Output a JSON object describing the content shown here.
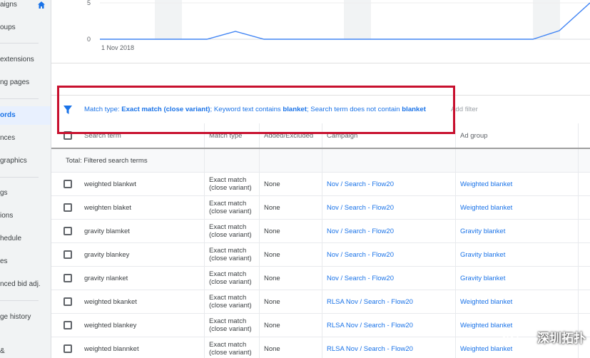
{
  "sidebar": {
    "items": [
      {
        "label": "aigns",
        "active": false
      },
      {
        "label": "oups",
        "active": false
      },
      {
        "label": "extensions",
        "active": false
      },
      {
        "label": "ng pages",
        "active": false
      },
      {
        "label": "ords",
        "active": true
      },
      {
        "label": "nces",
        "active": false
      },
      {
        "label": "graphics",
        "active": false
      },
      {
        "label": "gs",
        "active": false
      },
      {
        "label": "ions",
        "active": false
      },
      {
        "label": "hedule",
        "active": false
      },
      {
        "label": "es",
        "active": false
      },
      {
        "label": "nced bid adj.",
        "active": false
      },
      {
        "label": "ge history",
        "active": false
      },
      {
        "label": "&",
        "active": false
      }
    ],
    "home_icon": "home-icon"
  },
  "chart": {
    "yticks": [
      "5",
      "0"
    ],
    "xlabel": "1 Nov 2018",
    "colors": {
      "line": "#4285f4",
      "band": "#f1f3f4"
    }
  },
  "filter": {
    "icon": "filter-icon",
    "parts": [
      {
        "text": "Match type: ",
        "bold": false
      },
      {
        "text": "Exact match (close variant)",
        "bold": true
      },
      {
        "text": "; Keyword text contains ",
        "bold": false
      },
      {
        "text": "blanket",
        "bold": true
      },
      {
        "text": "; Search term does not contain ",
        "bold": false
      },
      {
        "text": "blanket",
        "bold": true
      }
    ],
    "add_filter": "Add filter",
    "highlight_color": "#c8102e"
  },
  "table": {
    "headers": {
      "search_term": "Search term",
      "match_type": "Match type",
      "added_excluded": "Added/Excluded",
      "campaign": "Campaign",
      "ad_group": "Ad group"
    },
    "total_label": "Total: Filtered search terms",
    "rows": [
      {
        "term": "weighted blankwt",
        "match1": "Exact match",
        "match2": "(close variant)",
        "added": "None",
        "campaign": "Nov / Search - Flow20",
        "adgroup": "Weighted blanket"
      },
      {
        "term": "weighten blaket",
        "match1": "Exact match",
        "match2": "(close variant)",
        "added": "None",
        "campaign": "Nov / Search - Flow20",
        "adgroup": "Weighted blanket"
      },
      {
        "term": "gravity blamket",
        "match1": "Exact match",
        "match2": "(close variant)",
        "added": "None",
        "campaign": "Nov / Search - Flow20",
        "adgroup": "Gravity blanket"
      },
      {
        "term": "gravity blankey",
        "match1": "Exact match",
        "match2": "(close variant)",
        "added": "None",
        "campaign": "Nov / Search - Flow20",
        "adgroup": "Gravity blanket"
      },
      {
        "term": "gravity nlanket",
        "match1": "Exact match",
        "match2": "(close variant)",
        "added": "None",
        "campaign": "Nov / Search - Flow20",
        "adgroup": "Gravity blanket"
      },
      {
        "term": "weighted bkanket",
        "match1": "Exact match",
        "match2": "(close variant)",
        "added": "None",
        "campaign": "RLSA Nov / Search - Flow20",
        "adgroup": "Weighted blanket"
      },
      {
        "term": "weighted blankey",
        "match1": "Exact match",
        "match2": "(close variant)",
        "added": "None",
        "campaign": "RLSA Nov / Search - Flow20",
        "adgroup": "Weighted blanket"
      },
      {
        "term": "weighted blannket",
        "match1": "Exact match",
        "match2": "(close variant)",
        "added": "None",
        "campaign": "RLSA Nov / Search - Flow20",
        "adgroup": "Weighted blanket"
      }
    ]
  },
  "watermark": {
    "text": "深圳拓扑",
    "icon": "wechat-logo-icon"
  }
}
